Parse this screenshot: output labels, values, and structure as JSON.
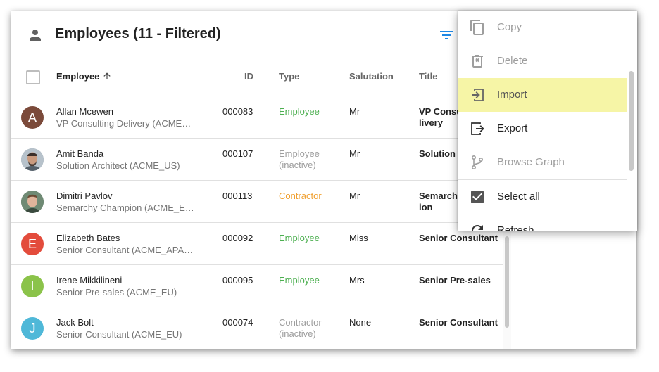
{
  "header": {
    "title": "Employees (11 - Filtered)"
  },
  "columns": {
    "employee": "Employee",
    "id": "ID",
    "type": "Type",
    "salutation": "Salutation",
    "title": "Title"
  },
  "rows": [
    {
      "avatar_letter": "A",
      "avatar_color": "#7b4a3a",
      "name": "Allan Mcewen",
      "subtitle": "VP Consulting Delivery (ACME…",
      "id": "000083",
      "type": "Employee",
      "type_color": "#4caf50",
      "salutation": "Mr",
      "title": "VP Consu\nlivery"
    },
    {
      "avatar_letter": "",
      "avatar_color": "#9aa6b0",
      "name": "Amit Banda",
      "subtitle": "Solution Architect (ACME_US)",
      "id": "000107",
      "type": "Employee (inactive)",
      "type_color": "#9e9e9e",
      "salutation": "Mr",
      "title": "Solution A"
    },
    {
      "avatar_letter": "",
      "avatar_color": "#6f8a74",
      "name": "Dimitri Pavlov",
      "subtitle": "Semarchy Champion (ACME_E…",
      "id": "000113",
      "type": "Contractor",
      "type_color": "#f0a030",
      "salutation": "Mr",
      "title": "Semarchy\nion"
    },
    {
      "avatar_letter": "E",
      "avatar_color": "#e34c3c",
      "name": "Elizabeth Bates",
      "subtitle": "Senior Consultant (ACME_APA…",
      "id": "000092",
      "type": "Employee",
      "type_color": "#4caf50",
      "salutation": "Miss",
      "title": "Senior Consultant"
    },
    {
      "avatar_letter": "I",
      "avatar_color": "#8bc34a",
      "name": "Irene Mikkilineni",
      "subtitle": "Senior Pre-sales (ACME_EU)",
      "id": "000095",
      "type": "Employee",
      "type_color": "#4caf50",
      "salutation": "Mrs",
      "title": "Senior Pre-sales"
    },
    {
      "avatar_letter": "J",
      "avatar_color": "#4fb8d8",
      "name": "Jack Bolt",
      "subtitle": "Senior Consultant (ACME_EU)",
      "id": "000074",
      "type": "Contractor (inactive)",
      "type_color": "#9e9e9e",
      "salutation": "None",
      "title": "Senior Consultant"
    }
  ],
  "menu": {
    "items": [
      {
        "label": "Copy",
        "icon": "copy-icon",
        "disabled": true
      },
      {
        "label": "Delete",
        "icon": "delete-icon",
        "disabled": true
      },
      {
        "label": "Import",
        "icon": "import-icon",
        "highlighted": true
      },
      {
        "label": "Export",
        "icon": "export-icon"
      },
      {
        "label": "Browse Graph",
        "icon": "graph-icon",
        "disabled": true
      },
      {
        "label": "Select all",
        "icon": "checkbox-checked-icon"
      },
      {
        "label": "Refresh",
        "icon": "refresh-icon"
      }
    ]
  }
}
